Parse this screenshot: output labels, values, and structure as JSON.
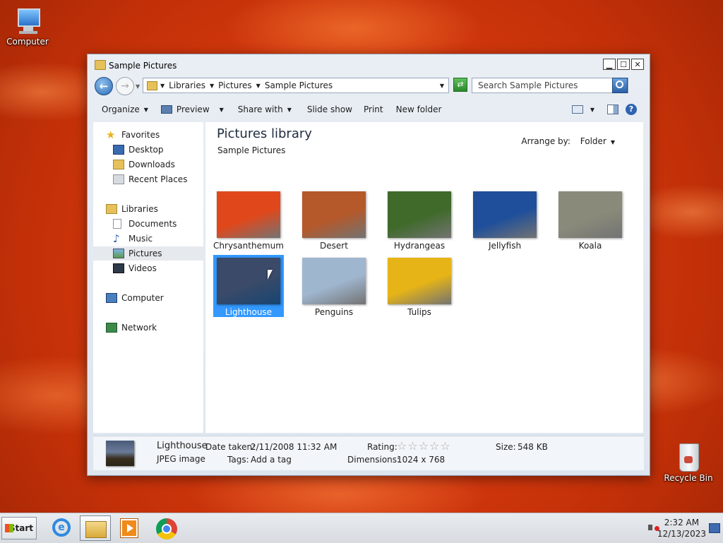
{
  "desktop": {
    "icons": [
      {
        "label": "Computer"
      },
      {
        "label": "Recycle Bin"
      }
    ]
  },
  "window": {
    "title": "Sample Pictures",
    "controls": {
      "minimize": "▁",
      "maximize": "☐",
      "close": "✕"
    },
    "address": {
      "crumbs": [
        "Libraries",
        "Pictures",
        "Sample Pictures"
      ]
    },
    "search": {
      "placeholder": "Search Sample Pictures"
    },
    "toolbar": {
      "organize": "Organize",
      "preview": "Preview",
      "share_with": "Share with",
      "slide_show": "Slide show",
      "print": "Print",
      "new_folder": "New folder"
    },
    "nav": {
      "favorites": "Favorites",
      "desktop": "Desktop",
      "downloads": "Downloads",
      "recent_places": "Recent Places",
      "libraries": "Libraries",
      "documents": "Documents",
      "music": "Music",
      "pictures": "Pictures",
      "videos": "Videos",
      "computer": "Computer",
      "network": "Network"
    },
    "library": {
      "title": "Pictures library",
      "subtitle": "Sample Pictures",
      "arrange_label": "Arrange by:",
      "arrange_value": "Folder"
    },
    "files": [
      {
        "name": "Chrysanthemum",
        "color": "#e0481c"
      },
      {
        "name": "Desert",
        "color": "#b5582a"
      },
      {
        "name": "Hydrangeas",
        "color": "#3f6a2a"
      },
      {
        "name": "Jellyfish",
        "color": "#1f4f9a"
      },
      {
        "name": "Koala",
        "color": "#8a8a7a"
      },
      {
        "name": "Lighthouse",
        "color": "#3a4a68",
        "selected": true
      },
      {
        "name": "Penguins",
        "color": "#9fb6cf"
      },
      {
        "name": "Tulips",
        "color": "#e6b417"
      }
    ],
    "details": {
      "name": "Lighthouse",
      "type": "JPEG image",
      "date_taken_label": "Date taken:",
      "date_taken": "2/11/2008 11:32 AM",
      "tags_label": "Tags:",
      "tags": "Add a tag",
      "rating_label": "Rating:",
      "rating": 0,
      "rating_max": 5,
      "dimensions_label": "Dimensions:",
      "dimensions": "1024 x 768",
      "size_label": "Size:",
      "size": "548 KB"
    }
  },
  "taskbar": {
    "start": "Start",
    "time": "2:32 AM",
    "date": "12/13/2023"
  }
}
